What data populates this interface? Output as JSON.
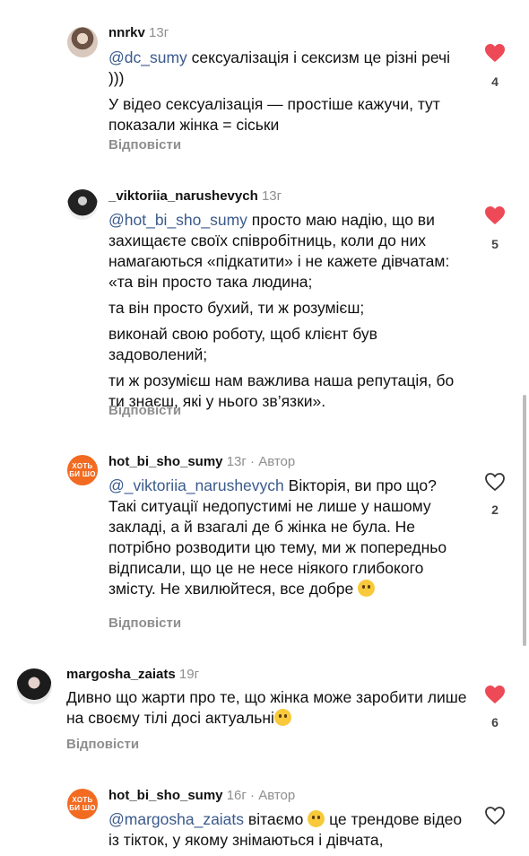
{
  "comments": [
    {
      "username": "nnrkv",
      "time": "13г",
      "mention": "@dc_sumy",
      "first_text": " сексуалізація і сексизм це різні речі )))",
      "extra": [
        "У відео сексуалізація — простіше кажучи, тут показали жінка = сіськи"
      ],
      "reply": "Відповісти",
      "likes": "4",
      "liked": true
    },
    {
      "username": "_viktoriia_narushevych",
      "time": "13г",
      "mention": "@hot_bi_sho_sumy",
      "first_text": " просто маю надію, що ви захищаєте своїх співробітниць, коли до них намагаються «підкатити» і не кажете дівчатам: «та він просто така людина;",
      "extra": [
        "та він просто бухий, ти ж розумієш;",
        "виконай свою роботу, щоб клієнт був задоволений;",
        "ти ж розумієш нам важлива наша репутація, бо ти знаєш, які у нього зв’язки»."
      ],
      "reply": "Відповісти",
      "likes": "5",
      "liked": true
    },
    {
      "username": "hot_bi_sho_sumy",
      "time": "13г",
      "author": "· Автор",
      "mention": "@_viktoriia_narushevych",
      "first_text": " Вікторія, ви про що? Такі ситуації недопустимі не лише у нашому закладі, а й взагалі де б жінка не була. Не потрібно розводити цю тему, ми ж попередньо відписали, що це не несе ніякого глибокого змісту. Не хвилюйтеся, все добре",
      "reply": "Відповісти",
      "likes": "2",
      "liked": false
    },
    {
      "username": "margosha_zaiats",
      "time": "19г",
      "text": "Дивно що жарти про те, що жінка може заробити лише на своєму тілі досі актуальні",
      "reply": "Відповісти",
      "likes": "6",
      "liked": true
    },
    {
      "username": "hot_bi_sho_sumy",
      "time": "16г",
      "author": "· Автор",
      "mention": "@margosha_zaiats",
      "first_text": " вітаємо",
      "after_emoji": " це трендове відео із тікток, у якому знімаються і дівчата,",
      "liked": false
    }
  ],
  "brand_avatar_text": "ХОТЬ БИ ШО",
  "colors": {
    "like_red": "#ed4956",
    "mention": "#3a5a8c",
    "muted": "#8e8e8e",
    "brand": "#f26b21"
  }
}
